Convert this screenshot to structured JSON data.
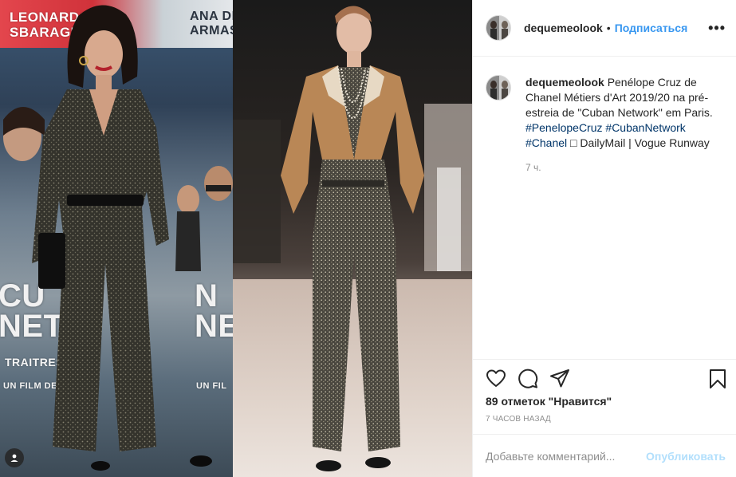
{
  "post": {
    "username": "dequemeolook",
    "separator": "•",
    "follow_label": "Подписаться",
    "more_label": "•••"
  },
  "caption": {
    "username": "dequemeolook",
    "text_part1": "Penélope Cruz de Chanel Métiers d'Art 2019/20 na pré-estreia de \"Cuban Network\" em Paris.",
    "tag1": "#PenelopeCruz",
    "tag2": "#CubanNetwork",
    "tag3": "#Chanel",
    "text_part2": "□ DailyMail | Vogue Runway",
    "time": "7 ч."
  },
  "actions": {
    "icons": [
      "heart-icon",
      "comment-icon",
      "share-icon",
      "bookmark-icon"
    ]
  },
  "likes_text": "89 отметок \"Нравится\"",
  "post_date": "7 ЧАСОВ НАЗАД",
  "comment": {
    "placeholder": "Добавьте комментарий...",
    "publish_label": "Опубликовать"
  },
  "photo": {
    "poster_name1": "LEONARDO\nSBARAGLIA",
    "poster_name2": "ANA DE\nARMAS",
    "poster_big": "CU\nNETV",
    "poster_big2": "N\nNETV",
    "poster_small": "TRAITRES",
    "poster_small2": "UN FILM DE OLI",
    "poster_small3": "UN FIL"
  },
  "colors": {
    "link": "#003569",
    "follow": "#3897f0",
    "publish_disabled": "#b2dffc",
    "muted": "#8e8e8e"
  }
}
